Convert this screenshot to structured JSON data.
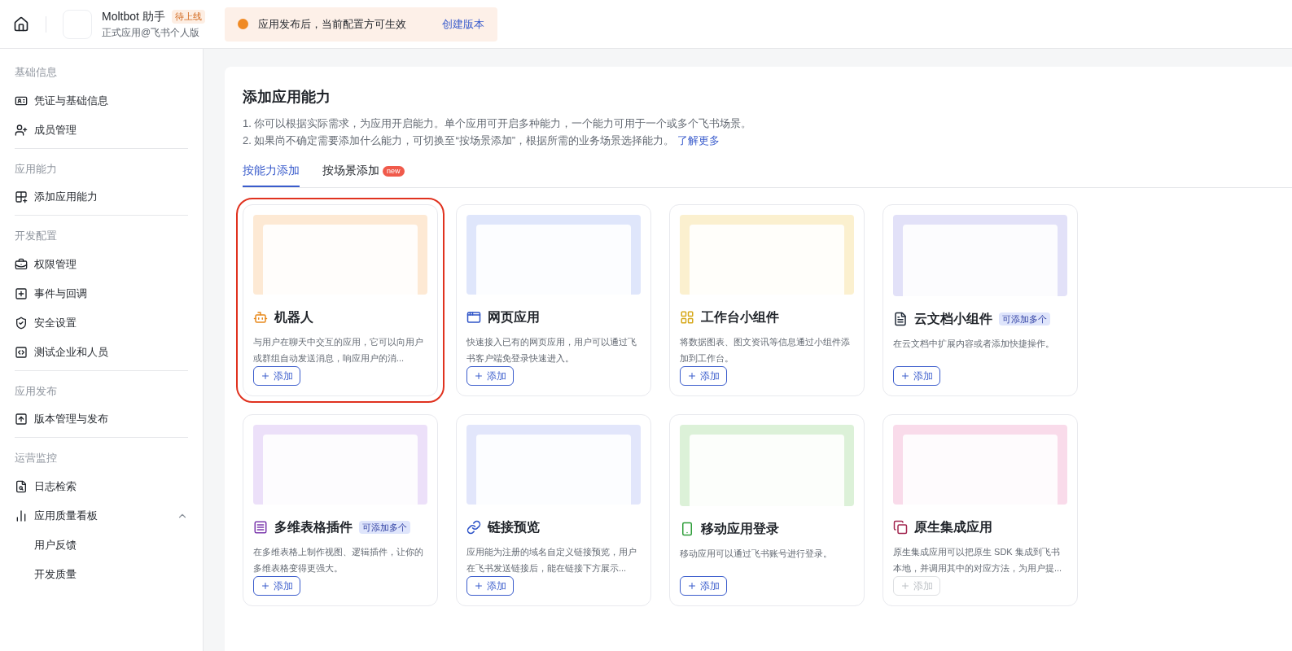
{
  "header": {
    "app_name": "Moltbot 助手",
    "status_badge": "待上线",
    "app_type": "正式应用@飞书个人版",
    "notice": {
      "text": "应用发布后，当前配置方可生效",
      "link": "创建版本"
    }
  },
  "sidebar": {
    "sections": [
      {
        "title": "基础信息",
        "items": [
          {
            "label": "凭证与基础信息"
          },
          {
            "label": "成员管理"
          }
        ]
      },
      {
        "title": "应用能力",
        "items": [
          {
            "label": "添加应用能力"
          }
        ]
      },
      {
        "title": "开发配置",
        "items": [
          {
            "label": "权限管理"
          },
          {
            "label": "事件与回调"
          },
          {
            "label": "安全设置"
          },
          {
            "label": "测试企业和人员"
          }
        ]
      },
      {
        "title": "应用发布",
        "items": [
          {
            "label": "版本管理与发布"
          }
        ]
      },
      {
        "title": "运营监控",
        "items": [
          {
            "label": "日志检索"
          },
          {
            "label": "应用质量看板",
            "expanded": true,
            "children": [
              {
                "label": "用户反馈"
              },
              {
                "label": "开发质量"
              }
            ]
          }
        ]
      }
    ]
  },
  "page": {
    "title": "添加应用能力",
    "notes": [
      "1. 你可以根据实际需求，为应用开启能力。单个应用可开启多种能力，一个能力可用于一个或多个飞书场景。",
      "2. 如果尚不确定需要添加什么能力，可切换至“按场景添加”，根据所需的业务场景选择能力。"
    ],
    "learn_more": "了解更多",
    "tabs": [
      {
        "label": "按能力添加",
        "selected": true
      },
      {
        "label": "按场景添加",
        "selected": false,
        "badge": "new"
      }
    ],
    "cards": [
      {
        "title": "机器人",
        "kind": "robot",
        "description": "与用户在聊天中交互的应用，它可以向用户或群组自动发送消息，响应用户的消...",
        "add": "添加",
        "disabled": false,
        "highlighted": true
      },
      {
        "title": "网页应用",
        "kind": "web",
        "description": "快速接入已有的网页应用，用户可以通过飞书客户端免登录快速进入。",
        "add": "添加",
        "disabled": false,
        "highlighted": false
      },
      {
        "title": "工作台小组件",
        "kind": "widget",
        "description": "将数据图表、图文资讯等信息通过小组件添加到工作台。",
        "add": "添加",
        "disabled": false,
        "highlighted": false
      },
      {
        "title": "云文档小组件",
        "kind": "doc",
        "badge": "可添加多个",
        "description": "在云文档中扩展内容或者添加快捷操作。",
        "add": "添加",
        "disabled": false,
        "highlighted": false
      },
      {
        "title": "多维表格插件",
        "kind": "table",
        "badge": "可添加多个",
        "description": "在多维表格上制作视图、逻辑插件，让你的多维表格变得更强大。",
        "add": "添加",
        "disabled": false,
        "highlighted": false
      },
      {
        "title": "链接预览",
        "kind": "link",
        "description": "应用能为注册的域名自定义链接预览，用户在飞书发送链接后，能在链接下方展示...",
        "add": "添加",
        "disabled": false,
        "highlighted": false
      },
      {
        "title": "移动应用登录",
        "kind": "mobile",
        "description": "移动应用可以通过飞书账号进行登录。",
        "add": "添加",
        "disabled": false,
        "highlighted": false
      },
      {
        "title": "原生集成应用",
        "kind": "native",
        "description": "原生集成应用可以把原生 SDK 集成到飞书本地，并调用其中的对应方法，为用户提...",
        "add": "添加",
        "disabled": true,
        "highlighted": false
      }
    ]
  }
}
